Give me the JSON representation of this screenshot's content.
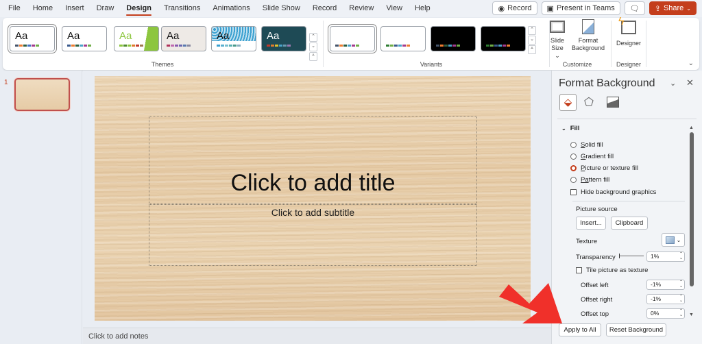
{
  "menu": {
    "tabs": [
      "File",
      "Home",
      "Insert",
      "Draw",
      "Design",
      "Transitions",
      "Animations",
      "Slide Show",
      "Record",
      "Review",
      "View",
      "Help"
    ],
    "active_tab": "Design",
    "record_label": "Record",
    "present_label": "Present in Teams",
    "share_label": "Share"
  },
  "ribbon": {
    "themes_label": "Themes",
    "variants_label": "Variants",
    "customize_label": "Customize",
    "designer_group_label": "Designer",
    "theme_sample_text": "Aa",
    "slide_size_label_1": "Slide",
    "slide_size_label_2": "Size",
    "format_bg_label_1": "Format",
    "format_bg_label_2": "Background",
    "designer_label": "Designer",
    "themes": [
      {
        "bg": "#ffffff",
        "text": "#111111",
        "swatches": [
          "#44546a",
          "#ed7d31",
          "#2e5e3e",
          "#4472c4",
          "#a33d8f",
          "#70ad47"
        ]
      },
      {
        "bg": "#ffffff",
        "text": "#111111",
        "swatches": [
          "#3a5a8c",
          "#ed7d31",
          "#2e5e3e",
          "#4aa3c9",
          "#a33d8f",
          "#70ad47"
        ]
      },
      {
        "bg": "#ffffff",
        "text": "#8dc63f",
        "swatches": [
          "#8dc63f",
          "#4e8b2c",
          "#8dc63f",
          "#e07b2c",
          "#c0392b",
          "#a07850"
        ]
      },
      {
        "bg": "#eeeae6",
        "text": "#111111",
        "swatches": [
          "#b0335a",
          "#c06ab0",
          "#8a5ab0",
          "#6a6ab0",
          "#5a7ab0",
          "#8a8aa0"
        ]
      },
      {
        "bg": "#ffffff",
        "text": "#111111",
        "swatches": [
          "#3aa0d0",
          "#5ab0d0",
          "#7ac0d0",
          "#5ab0b0",
          "#4a9a8a",
          "#8ab0c0"
        ]
      },
      {
        "bg": "#1e4a55",
        "text": "#ffffff",
        "swatches": [
          "#c0392b",
          "#e07b2c",
          "#e0c02c",
          "#4aa3c9",
          "#6a9ab0",
          "#9a7ab0"
        ]
      }
    ],
    "variants": [
      {
        "bg": "#ffffff",
        "swatches": [
          "#44546a",
          "#ed7d31",
          "#2e5e3e",
          "#4aa3c9",
          "#a33d8f",
          "#70ad47"
        ]
      },
      {
        "bg": "#ffffff",
        "swatches": [
          "#2e7d32",
          "#70ad47",
          "#3a5a8c",
          "#4aa3c9",
          "#a33d8f",
          "#ed7d31"
        ]
      },
      {
        "bg": "#000000",
        "swatches": [
          "#44546a",
          "#ed7d31",
          "#2e5e3e",
          "#4aa3c9",
          "#a33d8f",
          "#70ad47"
        ]
      },
      {
        "bg": "#000000",
        "swatches": [
          "#2e7d32",
          "#70ad47",
          "#3a5a8c",
          "#4aa3c9",
          "#a33d8f",
          "#ed7d31"
        ]
      }
    ]
  },
  "thumbnails": {
    "slide_number": "1"
  },
  "slide": {
    "title_placeholder": "Click to add title",
    "subtitle_placeholder": "Click to add subtitle"
  },
  "notes": {
    "placeholder": "Click to add notes"
  },
  "panel": {
    "title": "Format Background",
    "section": "Fill",
    "options": [
      {
        "label": "Solid fill",
        "key": "S",
        "rest": "olid fill",
        "checked": false
      },
      {
        "label": "Gradient fill",
        "key": "G",
        "rest": "radient fill",
        "checked": false
      },
      {
        "label": "Picture or texture fill",
        "key": "P",
        "rest": "icture or texture fill",
        "checked": true
      },
      {
        "label": "Pattern fill",
        "key": "Pa",
        "rest": "ttern fill",
        "checked": false
      }
    ],
    "hide_bg_graphics": "Hide background graphics",
    "picture_source": "Picture source",
    "insert_button": "Insert...",
    "clipboard_button": "Clipboard",
    "texture_label": "Texture",
    "transparency_label": "Transparency",
    "transparency_value": "1%",
    "tile_label": "Tile picture as texture",
    "offset_left_label": "Offset left",
    "offset_left_value": "-1%",
    "offset_right_label": "Offset right",
    "offset_right_value": "-1%",
    "offset_top_label": "Offset top",
    "offset_top_value": "0%",
    "apply_all_button": "Apply to All",
    "reset_button": "Reset Background"
  },
  "annotation": {
    "arrow_color": "#f0302a"
  }
}
